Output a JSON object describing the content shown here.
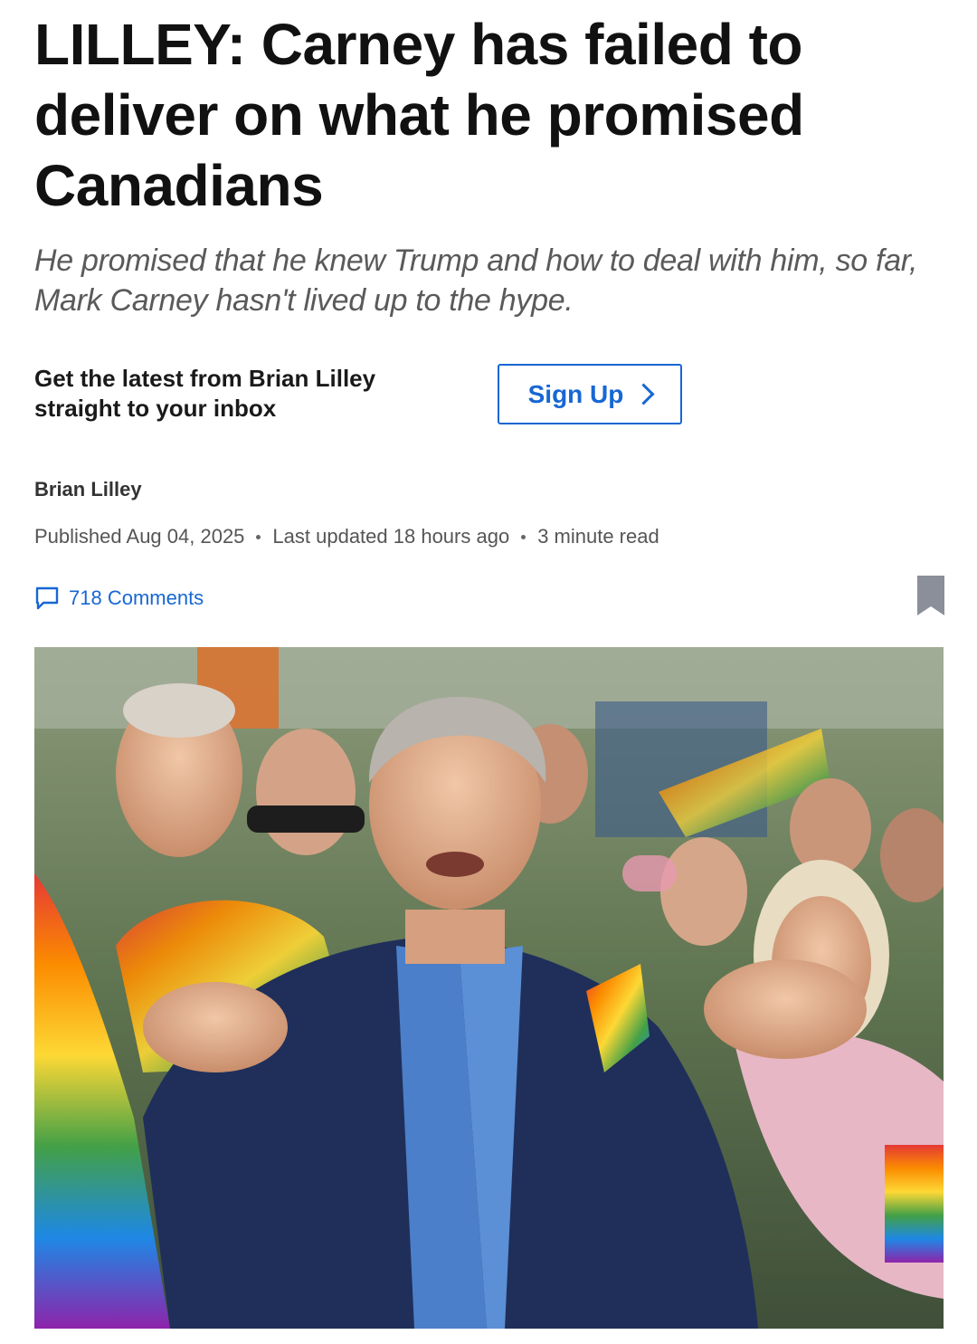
{
  "article": {
    "headline": "LILLEY: Carney has failed to deliver on what he promised Canadians",
    "deck": "He promised that he knew Trump and how to deal with him, so far, Mark Carney hasn't lived up to the hype."
  },
  "newsletter": {
    "prompt": "Get the latest from Brian Lilley straight to your inbox",
    "button_label": "Sign Up"
  },
  "byline": {
    "author": "Brian Lilley",
    "published": "Published Aug 04, 2025",
    "updated": "Last updated 18 hours ago",
    "read_time": "3 minute read"
  },
  "engagement": {
    "comments": "718 Comments"
  },
  "colors": {
    "link_blue": "#1767d3",
    "bookmark_gray": "#8a8f99"
  },
  "icons": {
    "comments": "speech-bubble-icon",
    "bookmark": "bookmark-icon",
    "signup_arrow": "chevron-right-icon"
  }
}
